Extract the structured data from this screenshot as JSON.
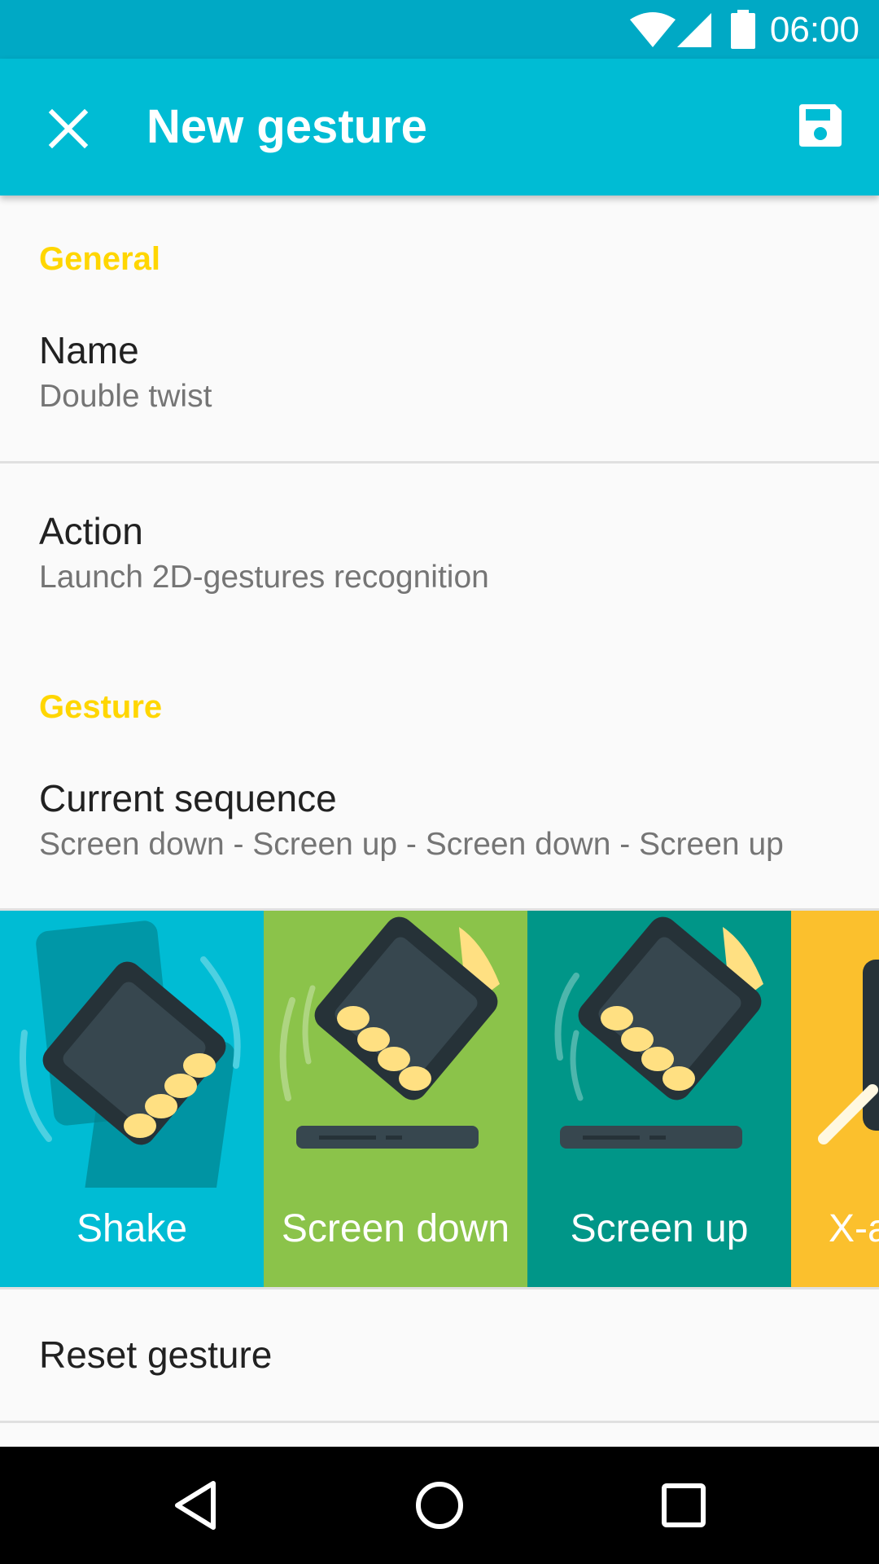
{
  "status_bar": {
    "time": "06:00"
  },
  "app_bar": {
    "title": "New gesture"
  },
  "sections": {
    "general": "General",
    "gesture": "Gesture"
  },
  "prefs": {
    "name": {
      "title": "Name",
      "summary": "Double twist"
    },
    "action": {
      "title": "Action",
      "summary": "Launch 2D-gestures recognition"
    },
    "sequence": {
      "title": "Current sequence",
      "summary": "Screen down - Screen up - Screen down - Screen up"
    }
  },
  "gestures": [
    {
      "label": "Shake",
      "color": "#00BCD4"
    },
    {
      "label": "Screen down",
      "color": "#8BC34A"
    },
    {
      "label": "Screen up",
      "color": "#009688"
    },
    {
      "label": "X-a",
      "color": "#FBC02D"
    }
  ],
  "reset": {
    "label": "Reset gesture"
  },
  "icons": {
    "close": "close-icon",
    "save": "save-icon",
    "wifi": "wifi-icon",
    "signal": "signal-icon",
    "battery": "battery-icon",
    "back": "back-icon",
    "home": "home-icon",
    "recents": "recents-icon"
  },
  "colors": {
    "primary": "#00BCD4",
    "primary_dark": "#00A9C5",
    "accent": "#FFD600"
  }
}
